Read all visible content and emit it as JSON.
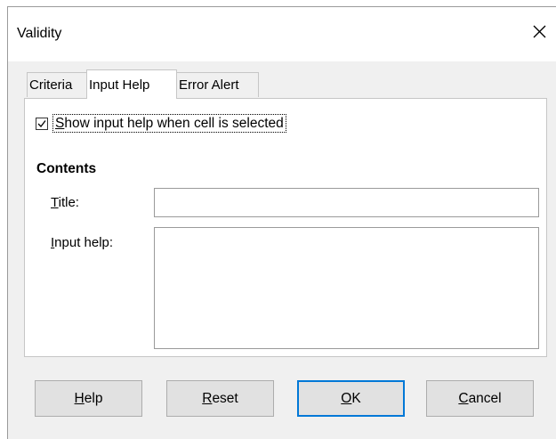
{
  "window": {
    "title": "Validity"
  },
  "tabs": [
    {
      "pre": "Criteria",
      "ul": "",
      "post": ""
    },
    {
      "pre": "Input Help",
      "ul": "",
      "post": ""
    },
    {
      "pre": "Error Alert",
      "ul": "",
      "post": ""
    }
  ],
  "active_tab": "Input Help",
  "input_help": {
    "show_checkbox": {
      "ul": "S",
      "rest": "how input help when cell is selected",
      "checked": true
    },
    "section_title": "Contents",
    "title_label": {
      "ul": "T",
      "rest": "itle:"
    },
    "title_value": "",
    "help_label": {
      "ul": "I",
      "rest": "nput help:"
    },
    "help_value": ""
  },
  "buttons": [
    {
      "ul": "H",
      "rest": "elp"
    },
    {
      "ul": "R",
      "rest": "eset"
    },
    {
      "ul": "O",
      "rest": "K"
    },
    {
      "ul": "C",
      "rest": "ancel"
    }
  ],
  "icons": {
    "close": "close-icon",
    "check": "checkmark-icon"
  },
  "colors": {
    "default_button_border": "#0078d7",
    "button_face": "#e1e1e1",
    "dialog_bg": "#f0f0f0"
  }
}
